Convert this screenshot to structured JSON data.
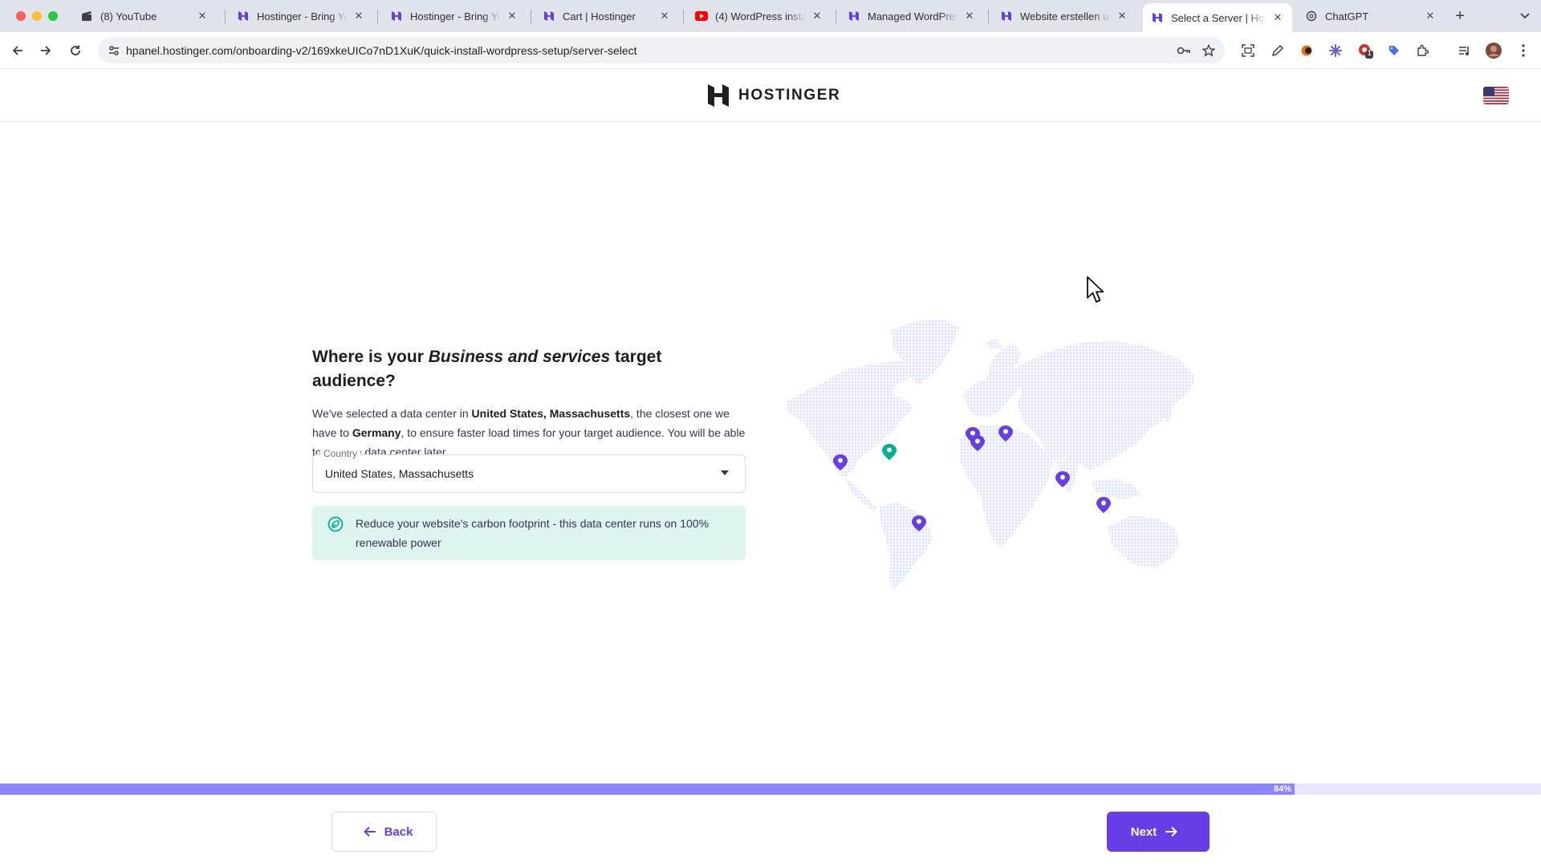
{
  "browser": {
    "tabs": [
      {
        "title": "(8) YouTube",
        "icon": "clapper-icon",
        "active": false
      },
      {
        "title": "Hostinger - Bring Your Idea Online",
        "icon": "hostinger-icon",
        "active": false
      },
      {
        "title": "Hostinger - Bring Your Idea Online",
        "icon": "hostinger-icon",
        "active": false
      },
      {
        "title": "Cart | Hostinger",
        "icon": "hostinger-icon",
        "active": false
      },
      {
        "title": "(4) WordPress installieren",
        "icon": "youtube-icon",
        "active": false
      },
      {
        "title": "Managed WordPress Hosting",
        "icon": "hostinger-icon",
        "active": false
      },
      {
        "title": "Website erstellen und hosten",
        "icon": "hostinger-icon",
        "active": false
      },
      {
        "title": "Select a Server | Hostinger",
        "icon": "hostinger-icon",
        "active": true
      },
      {
        "title": "ChatGPT",
        "icon": "chatgpt-icon",
        "active": false
      }
    ],
    "url": "hpanel.hostinger.com/onboarding-v2/169xkeUICo7nD1XuK/quick-install-wordpress-setup/server-select",
    "extension_badge": "1"
  },
  "header": {
    "logo_text": "HOSTINGER",
    "language_flag": "us-flag-icon"
  },
  "main": {
    "heading_pre": "Where is your ",
    "heading_em": "Business and services",
    "heading_post": " target audience?",
    "desc_1": "We've selected a data center in ",
    "desc_location": "United States, Massachusetts",
    "desc_2": ", the closest one we have to ",
    "desc_country": "Germany",
    "desc_3": ", to ensure faster load times for your target audience. You will be able to change data center later.",
    "country_label": "Country",
    "country_value": "United States, Massachusetts",
    "eco_text": "Reduce your website's carbon footprint - this data center runs on 100% renewable power"
  },
  "progress": {
    "value": 0.84,
    "label": "84%"
  },
  "footer": {
    "back_label": "Back",
    "next_label": "Next"
  },
  "colors": {
    "brand": "#673de6",
    "progress": "#8c85ff",
    "pin": "#673de6",
    "pin_selected": "#00b090",
    "map_land": "#dfe3ff",
    "eco_bg": "#def4f0"
  }
}
